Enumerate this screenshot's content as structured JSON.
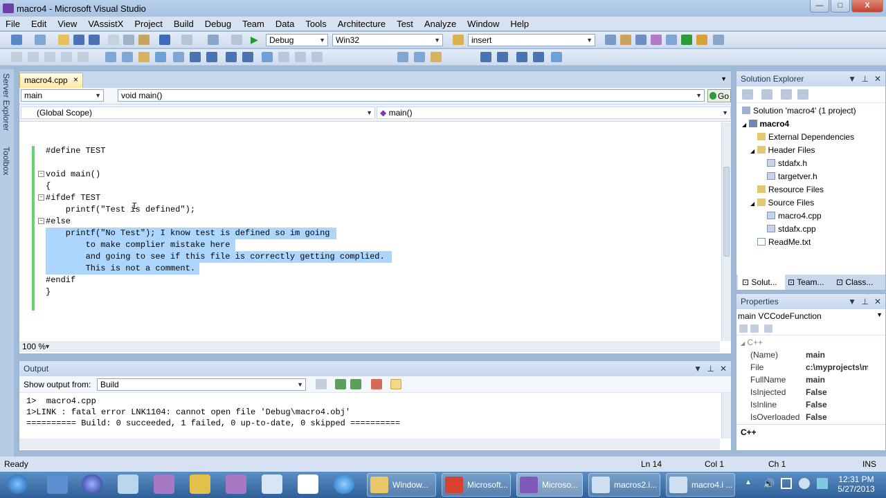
{
  "window": {
    "title": "macro4 - Microsoft Visual Studio",
    "min": "—",
    "max": "□",
    "close": "X"
  },
  "menu": [
    "File",
    "Edit",
    "View",
    "VAssistX",
    "Project",
    "Build",
    "Debug",
    "Team",
    "Data",
    "Tools",
    "Architecture",
    "Test",
    "Analyze",
    "Window",
    "Help"
  ],
  "toolbar": {
    "config": "Debug",
    "platform": "Win32",
    "find": "insert"
  },
  "side": {
    "server_explorer": "Server Explorer",
    "toolbox": "Toolbox"
  },
  "editor": {
    "tab": "macro4.cpp",
    "tab_close": "×",
    "nav_left": "main",
    "nav_right": "void main()",
    "go": "Go",
    "scope_left": "(Global Scope)",
    "scope_right": "main()",
    "zoom": "100 %",
    "lines": [
      {
        "t": "#define TEST"
      },
      {
        "t": ""
      },
      {
        "t": "void main()"
      },
      {
        "t": "{"
      },
      {
        "t": "#ifdef TEST"
      },
      {
        "t": "    printf(\"Test is defined\");"
      },
      {
        "t": "#else"
      },
      {
        "t": "    printf(\"No Test\"); I know test is defined so im going"
      },
      {
        "t": "        to make complier mistake here"
      },
      {
        "t": "        and going to see if this file is correctly getting complied."
      },
      {
        "t": "        This is not a comment."
      },
      {
        "t": "#endif"
      },
      {
        "t": "}"
      }
    ]
  },
  "solution_explorer": {
    "title": "Solution Explorer",
    "items": [
      "Solution 'macro4' (1 project)",
      "macro4",
      "External Dependencies",
      "Header Files",
      "stdafx.h",
      "targetver.h",
      "Resource Files",
      "Source Files",
      "macro4.cpp",
      "stdafx.cpp",
      "ReadMe.txt"
    ],
    "tabs": [
      "Solut...",
      "Team...",
      "Class..."
    ]
  },
  "properties": {
    "title": "Properties",
    "object": "main VCCodeFunction",
    "category": "C++",
    "rows": [
      {
        "name": "(Name)",
        "value": "main"
      },
      {
        "name": "File",
        "value": "c:\\myprojects\\m"
      },
      {
        "name": "FullName",
        "value": "main"
      },
      {
        "name": "IsInjected",
        "value": "False"
      },
      {
        "name": "IsInline",
        "value": "False"
      },
      {
        "name": "IsOverloaded",
        "value": "False"
      }
    ],
    "desc": "C++"
  },
  "output": {
    "title": "Output",
    "show_from_label": "Show output from:",
    "source": "Build",
    "lines": [
      "1>  macro4.cpp",
      "1>LINK : fatal error LNK1104: cannot open file 'Debug\\macro4.obj'",
      "========== Build: 0 succeeded, 1 failed, 0 up-to-date, 0 skipped =========="
    ]
  },
  "status": {
    "ready": "Ready",
    "ln": "Ln 14",
    "col": "Col 1",
    "ch": "Ch 1",
    "ins": "INS"
  },
  "taskbar": {
    "buttons": [
      "Window...",
      "Microsoft...",
      "Microso...",
      "macros2.i...",
      "macro4.i ..."
    ],
    "time": "12:31 PM",
    "date": "5/27/2013"
  }
}
